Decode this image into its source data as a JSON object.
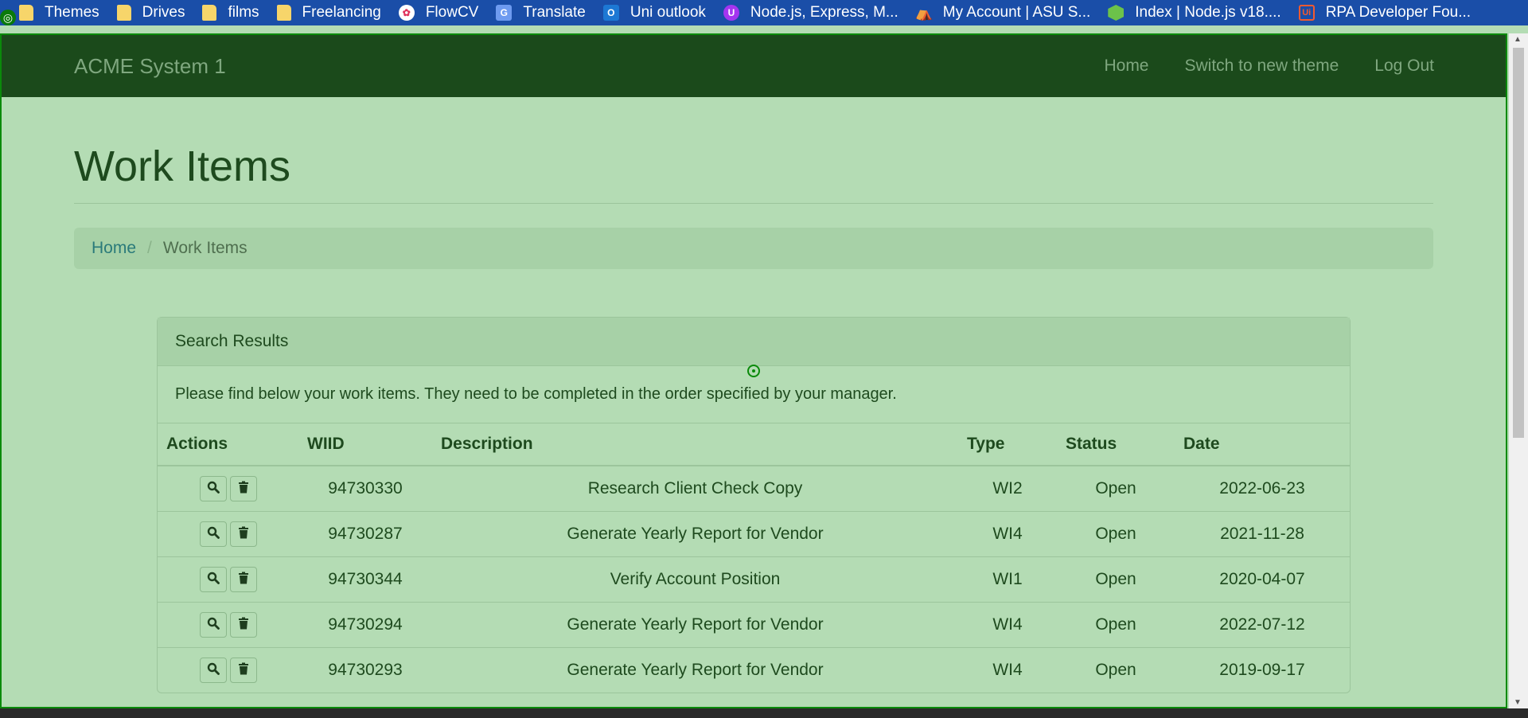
{
  "bookmarks": [
    {
      "label": "Themes",
      "icon": "folder-icon"
    },
    {
      "label": "Drives",
      "icon": "folder-icon"
    },
    {
      "label": "films",
      "icon": "folder-icon"
    },
    {
      "label": "Freelancing",
      "icon": "folder-icon"
    },
    {
      "label": "FlowCV",
      "icon": "flowcv-icon"
    },
    {
      "label": "Translate",
      "icon": "translate-icon"
    },
    {
      "label": "Uni outlook",
      "icon": "outlook-icon"
    },
    {
      "label": "Node.js, Express, M...",
      "icon": "udemy-icon"
    },
    {
      "label": "My Account | ASU S...",
      "icon": "asu-icon"
    },
    {
      "label": "Index | Node.js v18....",
      "icon": "nodejs-icon"
    },
    {
      "label": "RPA Developer Fou...",
      "icon": "uipath-icon"
    }
  ],
  "navbar": {
    "brand": "ACME System 1",
    "links": [
      "Home",
      "Switch to new theme",
      "Log Out"
    ]
  },
  "page": {
    "title": "Work Items",
    "breadcrumb": {
      "home": "Home",
      "separator": "/",
      "current": "Work Items"
    }
  },
  "panel": {
    "heading": "Search Results",
    "body": "Please find below your work items. They need to be completed in the order specified by your manager."
  },
  "table": {
    "headers": [
      "Actions",
      "WIID",
      "Description",
      "Type",
      "Status",
      "Date"
    ],
    "rows": [
      {
        "wiid": "94730330",
        "description": "Research Client Check Copy",
        "type": "WI2",
        "status": "Open",
        "date": "2022-06-23"
      },
      {
        "wiid": "94730287",
        "description": "Generate Yearly Report for Vendor",
        "type": "WI4",
        "status": "Open",
        "date": "2021-11-28"
      },
      {
        "wiid": "94730344",
        "description": "Verify Account Position",
        "type": "WI1",
        "status": "Open",
        "date": "2020-04-07"
      },
      {
        "wiid": "94730294",
        "description": "Generate Yearly Report for Vendor",
        "type": "WI4",
        "status": "Open",
        "date": "2022-07-12"
      },
      {
        "wiid": "94730293",
        "description": "Generate Yearly Report for Vendor",
        "type": "WI4",
        "status": "Open",
        "date": "2019-09-17"
      }
    ]
  },
  "colors": {
    "navbar": "#1b4a1b",
    "background": "#b4dcb4",
    "bookmarks_bar": "#1a4ea8"
  }
}
